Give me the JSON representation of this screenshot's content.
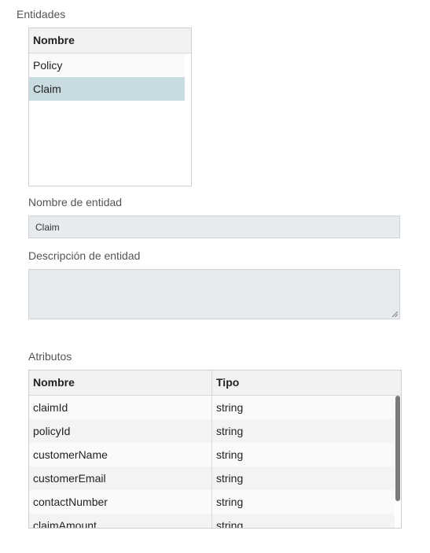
{
  "entities": {
    "section_label": "Entidades",
    "column_header": "Nombre",
    "items": [
      {
        "label": "Policy",
        "selected": false
      },
      {
        "label": "Claim",
        "selected": true
      }
    ]
  },
  "entity_name": {
    "label": "Nombre de entidad",
    "value": "Claim"
  },
  "entity_description": {
    "label": "Descripción de entidad",
    "value": ""
  },
  "attributes": {
    "section_label": "Atributos",
    "headers": [
      "Nombre",
      "Tipo"
    ],
    "rows": [
      {
        "name": "claimId",
        "type": "string"
      },
      {
        "name": "policyId",
        "type": "string"
      },
      {
        "name": "customerName",
        "type": "string"
      },
      {
        "name": "customerEmail",
        "type": "string"
      },
      {
        "name": "contactNumber",
        "type": "string"
      },
      {
        "name": "claimAmount",
        "type": "string"
      }
    ]
  },
  "colors": {
    "selected_row": "#c8dbe0",
    "input_bg": "#e8ebee",
    "header_bg": "#f2f2f2"
  }
}
